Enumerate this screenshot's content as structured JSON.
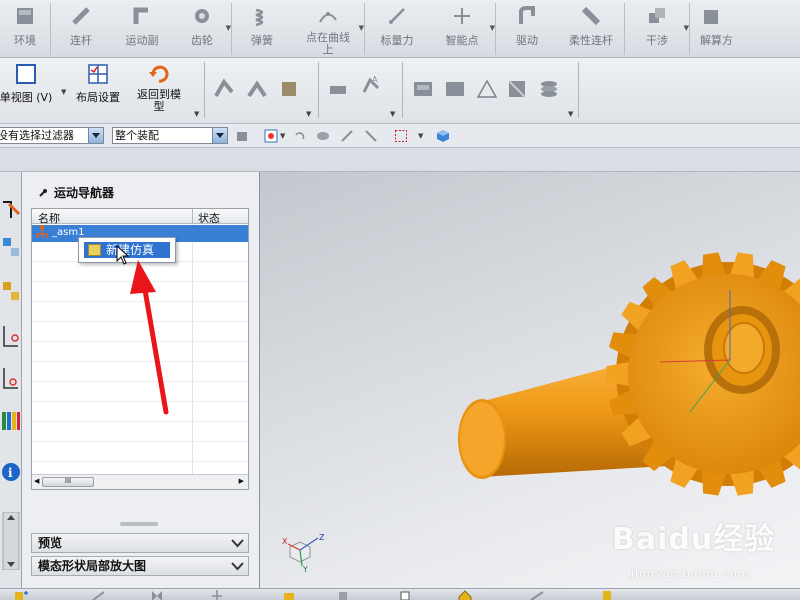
{
  "ribbon_top": {
    "items": [
      {
        "label": "环境",
        "icon": "environment-icon"
      },
      {
        "label": "连杆",
        "icon": "link-icon"
      },
      {
        "label": "运动副",
        "icon": "joint-icon"
      },
      {
        "label": "齿轮",
        "icon": "gear-icon"
      },
      {
        "label": "弹簧",
        "icon": "spring-icon"
      },
      {
        "label": "点在曲线上",
        "icon": "point-on-curve-icon"
      },
      {
        "label": "标量力",
        "icon": "scalar-force-icon"
      },
      {
        "label": "智能点",
        "icon": "smart-point-icon"
      },
      {
        "label": "驱动",
        "icon": "driver-icon"
      },
      {
        "label": "柔性连杆",
        "icon": "flexible-link-icon"
      },
      {
        "label": "干涉",
        "icon": "interference-icon"
      },
      {
        "label": "解算方",
        "icon": "solver-icon"
      }
    ]
  },
  "ribbon_second": {
    "single_view": "单视图 (V)",
    "layout_settings": "布局设置",
    "return_model_line1": "返回到模",
    "return_model_line2": "型"
  },
  "selection_bar": {
    "filter": "没有选择过滤器",
    "scope": "整个装配"
  },
  "navigator": {
    "title": "运动导航器",
    "col_name": "名称",
    "col_status": "状态",
    "root_item": "_asm1",
    "context_menu_item": "新建仿真",
    "scroll_marker": "III"
  },
  "sections": {
    "preview": "预览",
    "mode_shape": "模态形状局部放大图"
  },
  "watermark": {
    "main": "Baidu经验",
    "sub": "jingyan.baidu.com"
  },
  "axes": {
    "x": "X",
    "y": "Y",
    "z": "Z"
  },
  "colors": {
    "gear": "#f0a21c",
    "selection": "#3a7fd6",
    "arrow": "#e8161a"
  }
}
